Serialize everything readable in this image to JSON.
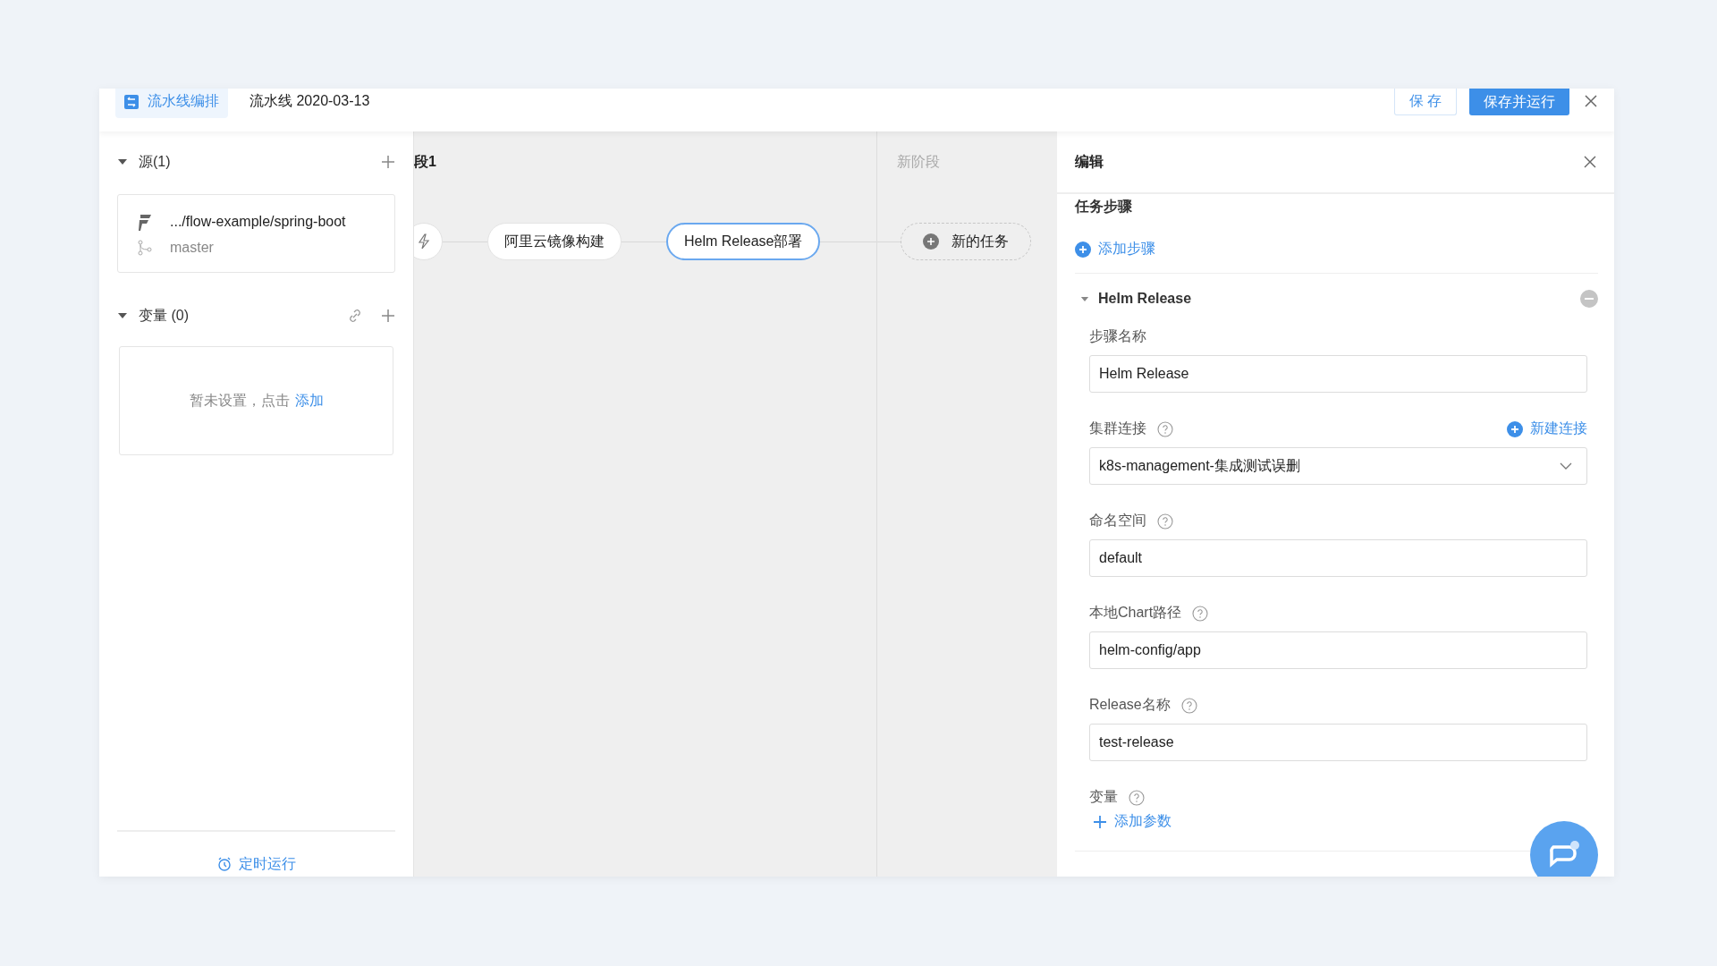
{
  "header": {
    "tab_label": "流水线编排",
    "title": "流水线 2020-03-13",
    "buttons": [
      {
        "label": "保 存",
        "kind": "secondary"
      },
      {
        "label": "保存并运行",
        "kind": "primary"
      }
    ]
  },
  "sidebar": {
    "sources": {
      "title": "源(1)",
      "expanded": true,
      "items": [
        {
          "repo": ".../flow-example/spring-boot",
          "branch": "master"
        }
      ]
    },
    "variables": {
      "title": "变量 (0)",
      "expanded": true,
      "empty_text": "暂未设置，点击",
      "add_link": "添加"
    },
    "footer_link": "定时运行"
  },
  "canvas": {
    "stages": [
      {
        "kind": "stage",
        "title": "段1",
        "tasks": [
          {
            "label": "阿里云镜像构建",
            "selected": false
          },
          {
            "label": "Helm Release部署",
            "selected": true
          }
        ]
      },
      {
        "kind": "new",
        "title": "新阶段",
        "new_task": "新的任务"
      }
    ]
  },
  "editor": {
    "title": "编辑",
    "section": "任务步骤",
    "add_step": "添加步骤",
    "step": {
      "name": "Helm Release",
      "expanded": true,
      "fields": [
        {
          "kind": "text",
          "label": "步骤名称",
          "help": false,
          "value": "Helm Release"
        },
        {
          "kind": "select",
          "label": "集群连接",
          "help": true,
          "value": "k8s-management-集成测试误删",
          "action": "新建连接"
        },
        {
          "kind": "text",
          "label": "命名空间",
          "help": true,
          "value": "default"
        },
        {
          "kind": "text",
          "label": "本地Chart路径",
          "help": true,
          "value": "helm-config/app"
        },
        {
          "kind": "text",
          "label": "Release名称",
          "help": true,
          "value": "test-release"
        },
        {
          "kind": "params",
          "label": "变量",
          "help": true,
          "action": "添加参数"
        }
      ]
    }
  }
}
